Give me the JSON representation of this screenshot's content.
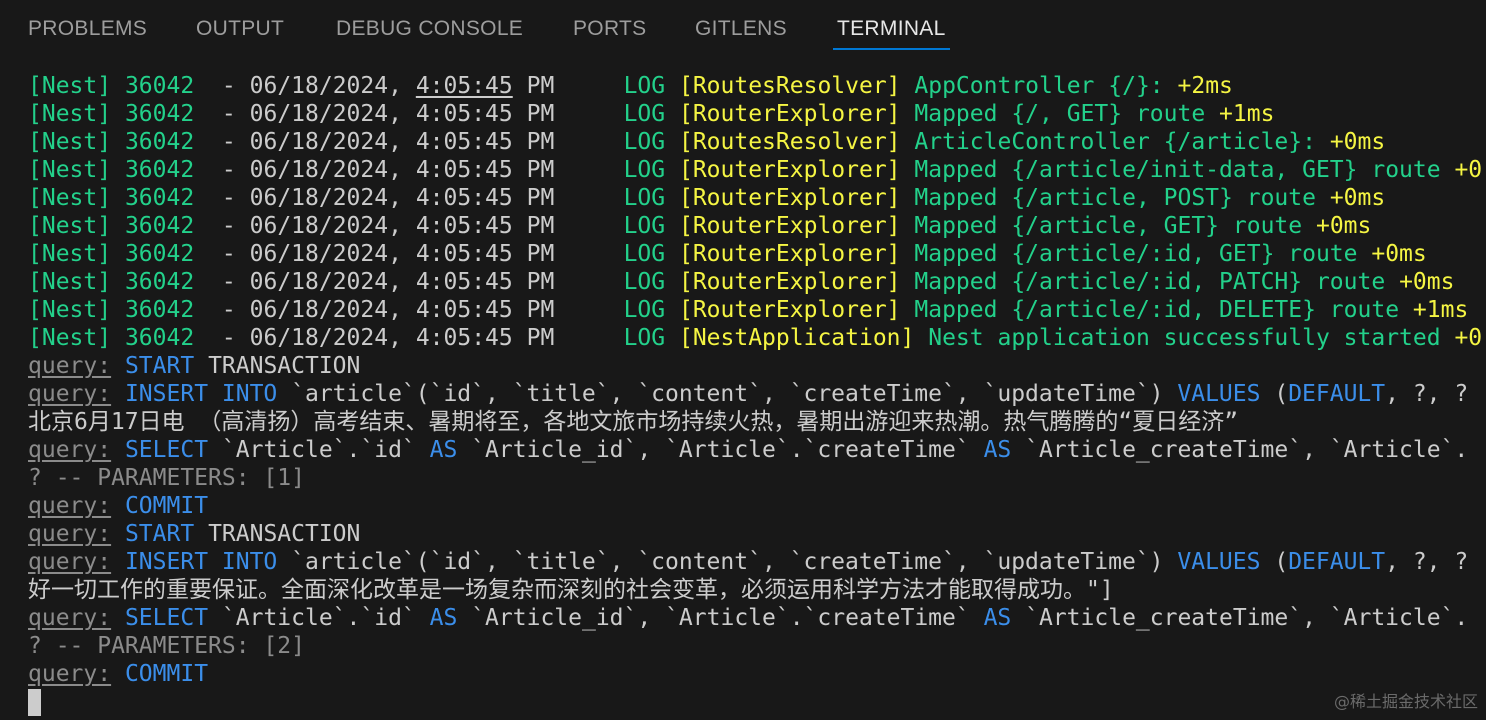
{
  "tabs": [
    {
      "label": "PROBLEMS",
      "active": false
    },
    {
      "label": "OUTPUT",
      "active": false
    },
    {
      "label": "DEBUG CONSOLE",
      "active": false
    },
    {
      "label": "PORTS",
      "active": false
    },
    {
      "label": "GITLENS",
      "active": false
    },
    {
      "label": "TERMINAL",
      "active": true
    }
  ],
  "terminal": {
    "nest_prefix": "[Nest]",
    "pid": "36042",
    "log_level": "LOG",
    "query_label": "query:",
    "nest_logs": [
      {
        "date": "06/18/2024,",
        "time": "4:05:45",
        "ampm": "PM",
        "context": "[RoutesResolver]",
        "message": "AppController {/}:",
        "timing": "+2ms"
      },
      {
        "date": "06/18/2024,",
        "time": "4:05:45",
        "ampm": "PM",
        "context": "[RouterExplorer]",
        "message": "Mapped {/, GET} route",
        "timing": "+1ms"
      },
      {
        "date": "06/18/2024,",
        "time": "4:05:45",
        "ampm": "PM",
        "context": "[RoutesResolver]",
        "message": "ArticleController {/article}:",
        "timing": "+0ms"
      },
      {
        "date": "06/18/2024,",
        "time": "4:05:45",
        "ampm": "PM",
        "context": "[RouterExplorer]",
        "message": "Mapped {/article/init-data, GET} route",
        "timing": "+0"
      },
      {
        "date": "06/18/2024,",
        "time": "4:05:45",
        "ampm": "PM",
        "context": "[RouterExplorer]",
        "message": "Mapped {/article, POST} route",
        "timing": "+0ms"
      },
      {
        "date": "06/18/2024,",
        "time": "4:05:45",
        "ampm": "PM",
        "context": "[RouterExplorer]",
        "message": "Mapped {/article, GET} route",
        "timing": "+0ms"
      },
      {
        "date": "06/18/2024,",
        "time": "4:05:45",
        "ampm": "PM",
        "context": "[RouterExplorer]",
        "message": "Mapped {/article/:id, GET} route",
        "timing": "+0ms"
      },
      {
        "date": "06/18/2024,",
        "time": "4:05:45",
        "ampm": "PM",
        "context": "[RouterExplorer]",
        "message": "Mapped {/article/:id, PATCH} route",
        "timing": "+0ms"
      },
      {
        "date": "06/18/2024,",
        "time": "4:05:45",
        "ampm": "PM",
        "context": "[RouterExplorer]",
        "message": "Mapped {/article/:id, DELETE} route",
        "timing": "+1ms"
      },
      {
        "date": "06/18/2024,",
        "time": "4:05:45",
        "ampm": "PM",
        "context": "[NestApplication]",
        "message": "Nest application successfully started",
        "timing": "+0"
      }
    ],
    "sql": {
      "start_kw": "START",
      "transaction": "TRANSACTION",
      "insert_kw": "INSERT INTO",
      "insert_cols": "`article`(`id`, `title`, `content`, `createTime`, `updateTime`)",
      "values_kw": "VALUES",
      "values_tail_pre": "(",
      "default_kw": "DEFAULT",
      "values_tail_post": ", ?, ?",
      "select_kw": "SELECT",
      "select_col1": "`Article`.`id`",
      "as_kw": "AS",
      "select_alias1": "`Article_id`,",
      "select_col2": "`Article`.`createTime`",
      "select_alias2": "`Article_createTime`,",
      "select_tail": "`Article`.",
      "params_label": "? -- PARAMETERS:",
      "params_1": "[1]",
      "params_2": "[2]",
      "commit": "COMMIT"
    },
    "content_line_1": "北京6月17日电 （高清扬）高考结束、暑期将至，各地文旅市场持续火热，暑期出游迎来热潮。热气腾腾的“夏日经济”",
    "content_line_2": "好一切工作的重要保证。全面深化改革是一场复杂而深刻的社会变革，必须运用科学方法才能取得成功。\"]"
  },
  "watermark": "@稀土掘金技术社区",
  "colors": {
    "green": "#23d18b",
    "yellow": "#f5f543",
    "blue": "#3b8eea",
    "dim": "#8b8b8b",
    "text": "#cccccc",
    "accent": "#0078d4",
    "background": "#181818"
  }
}
